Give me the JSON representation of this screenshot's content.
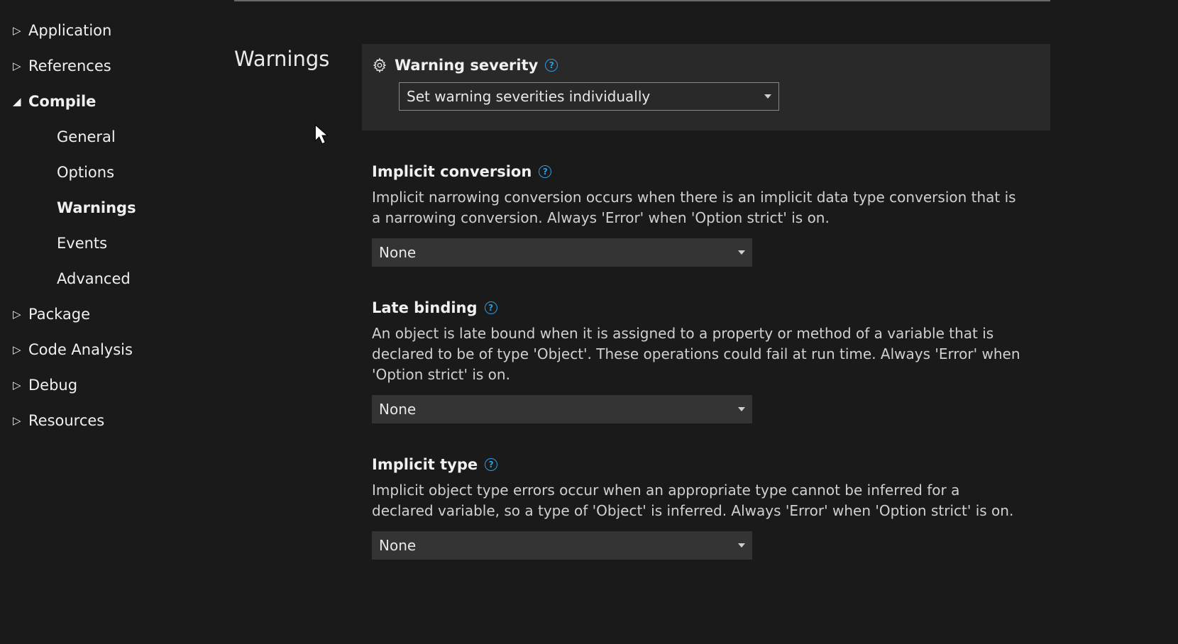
{
  "sidebar": {
    "items": [
      {
        "label": "Application",
        "level": "top",
        "expanded": false
      },
      {
        "label": "References",
        "level": "top",
        "expanded": false
      },
      {
        "label": "Compile",
        "level": "top",
        "expanded": true,
        "selected": false
      },
      {
        "label": "General",
        "level": "child"
      },
      {
        "label": "Options",
        "level": "child"
      },
      {
        "label": "Warnings",
        "level": "child",
        "selected": true
      },
      {
        "label": "Events",
        "level": "child"
      },
      {
        "label": "Advanced",
        "level": "child"
      },
      {
        "label": "Package",
        "level": "top",
        "expanded": false
      },
      {
        "label": "Code Analysis",
        "level": "top",
        "expanded": false
      },
      {
        "label": "Debug",
        "level": "top",
        "expanded": false
      },
      {
        "label": "Resources",
        "level": "top",
        "expanded": false
      }
    ]
  },
  "content": {
    "section_title": "Warnings",
    "header": {
      "label": "Warning severity",
      "select_value": "Set warning severities individually"
    },
    "settings": [
      {
        "label": "Implicit conversion",
        "description": "Implicit narrowing conversion occurs when there is an implicit data type conversion that is a narrowing conversion. Always 'Error' when 'Option strict' is on.",
        "select_value": "None"
      },
      {
        "label": "Late binding",
        "description": "An object is late bound when it is assigned to a property or method of a variable that is declared to be of type 'Object'. These operations could fail at run time. Always 'Error' when 'Option strict' is on.",
        "select_value": "None"
      },
      {
        "label": "Implicit type",
        "description": "Implicit object type errors occur when an appropriate type cannot be inferred for a declared variable, so a type of 'Object' is inferred. Always 'Error' when 'Option strict' is on.",
        "select_value": "None"
      }
    ]
  }
}
